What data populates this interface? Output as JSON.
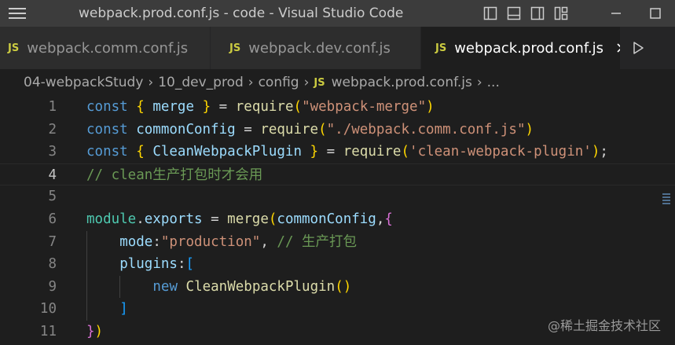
{
  "window": {
    "title": "webpack.prod.conf.js - code - Visual Studio Code"
  },
  "tabs": [
    {
      "icon": "JS",
      "label": "webpack.comm.conf.js",
      "active": false
    },
    {
      "icon": "JS",
      "label": "webpack.dev.conf.js",
      "active": false
    },
    {
      "icon": "JS",
      "label": "webpack.prod.conf.js",
      "active": true
    }
  ],
  "breadcrumb": {
    "items": [
      "04-webpackStudy",
      "10_dev_prod",
      "config"
    ],
    "file_icon": "JS",
    "file": "webpack.prod.conf.js",
    "more": "..."
  },
  "editor": {
    "current_line": 4,
    "lines": [
      {
        "n": "1",
        "t": "const { merge } = require(\"webpack-merge\")"
      },
      {
        "n": "2",
        "t": "const commonConfig = require(\"./webpack.comm.conf.js\")"
      },
      {
        "n": "3",
        "t": "const { CleanWebpackPlugin } = require('clean-webpack-plugin');"
      },
      {
        "n": "4",
        "t": "// clean生产打包时才会用"
      },
      {
        "n": "5",
        "t": ""
      },
      {
        "n": "6",
        "t": "module.exports = merge(commonConfig,{"
      },
      {
        "n": "7",
        "t": "    mode:\"production\", // 生产打包"
      },
      {
        "n": "8",
        "t": "    plugins:["
      },
      {
        "n": "9",
        "t": "        new CleanWebpackPlugin()"
      },
      {
        "n": "10",
        "t": "    ]"
      },
      {
        "n": "11",
        "t": "})"
      }
    ]
  },
  "watermark": "@稀土掘金技术社区",
  "colors": {
    "titlebar": "#3c3c3c",
    "editor_bg": "#1e1e1e",
    "keyword": "#569cd6",
    "string": "#ce9178",
    "comment": "#6a9955",
    "function": "#dcdcaa",
    "variable": "#9cdcfe",
    "class": "#4ec9b0",
    "js_badge": "#cbcb41"
  }
}
